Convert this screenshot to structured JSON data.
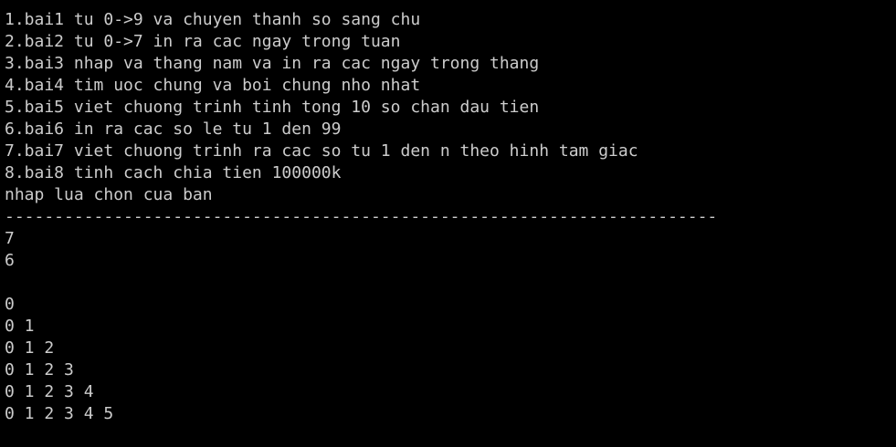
{
  "terminal": {
    "separator_top": "----------------------------------------------------------------------",
    "menu": [
      "1.bai1 tu 0->9 va chuyen thanh so sang chu",
      "2.bai2 tu 0->7 in ra cac ngay trong tuan",
      "3.bai3 nhap va thang nam va in ra cac ngay trong thang",
      "4.bai4 tim uoc chung va boi chung nho nhat",
      "5.bai5 viet chuong trinh tinh tong 10 so chan dau tien",
      "6.bai6 in ra cac so le tu 1 den 99",
      "7.bai7 viet chuong trinh ra cac so tu 1 den n theo hinh tam giac",
      "8.bai8 tinh cach chia tien 100000k"
    ],
    "prompt": "nhap lua chon cua ban",
    "separator_bottom": "------------------------------------------------------------------------",
    "input_choice": "7",
    "input_n": "6",
    "blank_line": "",
    "triangle": [
      "0",
      "0 1",
      "0 1 2",
      "0 1 2 3",
      "0 1 2 3 4",
      "0 1 2 3 4 5"
    ],
    "colors": {
      "background": "#000000",
      "foreground": "#cccccc"
    }
  }
}
